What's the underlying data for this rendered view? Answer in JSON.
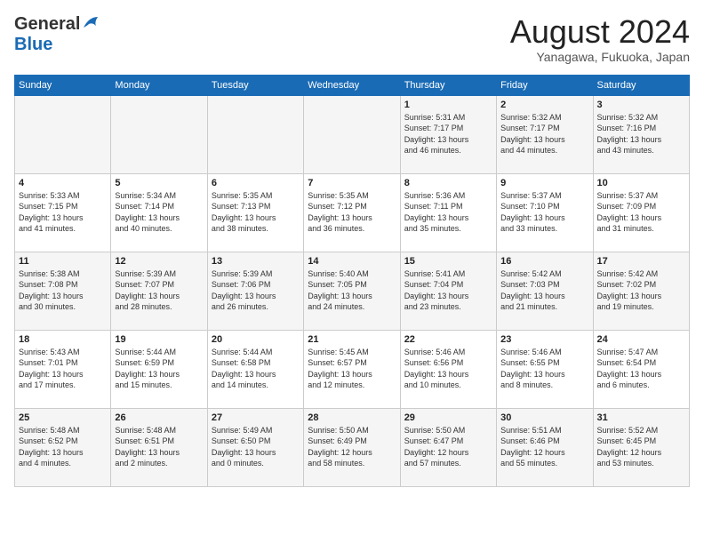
{
  "header": {
    "logo_general": "General",
    "logo_blue": "Blue",
    "month_title": "August 2024",
    "location": "Yanagawa, Fukuoka, Japan"
  },
  "calendar": {
    "days_of_week": [
      "Sunday",
      "Monday",
      "Tuesday",
      "Wednesday",
      "Thursday",
      "Friday",
      "Saturday"
    ],
    "weeks": [
      [
        {
          "day": "",
          "info": ""
        },
        {
          "day": "",
          "info": ""
        },
        {
          "day": "",
          "info": ""
        },
        {
          "day": "",
          "info": ""
        },
        {
          "day": "1",
          "info": "Sunrise: 5:31 AM\nSunset: 7:17 PM\nDaylight: 13 hours\nand 46 minutes."
        },
        {
          "day": "2",
          "info": "Sunrise: 5:32 AM\nSunset: 7:17 PM\nDaylight: 13 hours\nand 44 minutes."
        },
        {
          "day": "3",
          "info": "Sunrise: 5:32 AM\nSunset: 7:16 PM\nDaylight: 13 hours\nand 43 minutes."
        }
      ],
      [
        {
          "day": "4",
          "info": "Sunrise: 5:33 AM\nSunset: 7:15 PM\nDaylight: 13 hours\nand 41 minutes."
        },
        {
          "day": "5",
          "info": "Sunrise: 5:34 AM\nSunset: 7:14 PM\nDaylight: 13 hours\nand 40 minutes."
        },
        {
          "day": "6",
          "info": "Sunrise: 5:35 AM\nSunset: 7:13 PM\nDaylight: 13 hours\nand 38 minutes."
        },
        {
          "day": "7",
          "info": "Sunrise: 5:35 AM\nSunset: 7:12 PM\nDaylight: 13 hours\nand 36 minutes."
        },
        {
          "day": "8",
          "info": "Sunrise: 5:36 AM\nSunset: 7:11 PM\nDaylight: 13 hours\nand 35 minutes."
        },
        {
          "day": "9",
          "info": "Sunrise: 5:37 AM\nSunset: 7:10 PM\nDaylight: 13 hours\nand 33 minutes."
        },
        {
          "day": "10",
          "info": "Sunrise: 5:37 AM\nSunset: 7:09 PM\nDaylight: 13 hours\nand 31 minutes."
        }
      ],
      [
        {
          "day": "11",
          "info": "Sunrise: 5:38 AM\nSunset: 7:08 PM\nDaylight: 13 hours\nand 30 minutes."
        },
        {
          "day": "12",
          "info": "Sunrise: 5:39 AM\nSunset: 7:07 PM\nDaylight: 13 hours\nand 28 minutes."
        },
        {
          "day": "13",
          "info": "Sunrise: 5:39 AM\nSunset: 7:06 PM\nDaylight: 13 hours\nand 26 minutes."
        },
        {
          "day": "14",
          "info": "Sunrise: 5:40 AM\nSunset: 7:05 PM\nDaylight: 13 hours\nand 24 minutes."
        },
        {
          "day": "15",
          "info": "Sunrise: 5:41 AM\nSunset: 7:04 PM\nDaylight: 13 hours\nand 23 minutes."
        },
        {
          "day": "16",
          "info": "Sunrise: 5:42 AM\nSunset: 7:03 PM\nDaylight: 13 hours\nand 21 minutes."
        },
        {
          "day": "17",
          "info": "Sunrise: 5:42 AM\nSunset: 7:02 PM\nDaylight: 13 hours\nand 19 minutes."
        }
      ],
      [
        {
          "day": "18",
          "info": "Sunrise: 5:43 AM\nSunset: 7:01 PM\nDaylight: 13 hours\nand 17 minutes."
        },
        {
          "day": "19",
          "info": "Sunrise: 5:44 AM\nSunset: 6:59 PM\nDaylight: 13 hours\nand 15 minutes."
        },
        {
          "day": "20",
          "info": "Sunrise: 5:44 AM\nSunset: 6:58 PM\nDaylight: 13 hours\nand 14 minutes."
        },
        {
          "day": "21",
          "info": "Sunrise: 5:45 AM\nSunset: 6:57 PM\nDaylight: 13 hours\nand 12 minutes."
        },
        {
          "day": "22",
          "info": "Sunrise: 5:46 AM\nSunset: 6:56 PM\nDaylight: 13 hours\nand 10 minutes."
        },
        {
          "day": "23",
          "info": "Sunrise: 5:46 AM\nSunset: 6:55 PM\nDaylight: 13 hours\nand 8 minutes."
        },
        {
          "day": "24",
          "info": "Sunrise: 5:47 AM\nSunset: 6:54 PM\nDaylight: 13 hours\nand 6 minutes."
        }
      ],
      [
        {
          "day": "25",
          "info": "Sunrise: 5:48 AM\nSunset: 6:52 PM\nDaylight: 13 hours\nand 4 minutes."
        },
        {
          "day": "26",
          "info": "Sunrise: 5:48 AM\nSunset: 6:51 PM\nDaylight: 13 hours\nand 2 minutes."
        },
        {
          "day": "27",
          "info": "Sunrise: 5:49 AM\nSunset: 6:50 PM\nDaylight: 13 hours\nand 0 minutes."
        },
        {
          "day": "28",
          "info": "Sunrise: 5:50 AM\nSunset: 6:49 PM\nDaylight: 12 hours\nand 58 minutes."
        },
        {
          "day": "29",
          "info": "Sunrise: 5:50 AM\nSunset: 6:47 PM\nDaylight: 12 hours\nand 57 minutes."
        },
        {
          "day": "30",
          "info": "Sunrise: 5:51 AM\nSunset: 6:46 PM\nDaylight: 12 hours\nand 55 minutes."
        },
        {
          "day": "31",
          "info": "Sunrise: 5:52 AM\nSunset: 6:45 PM\nDaylight: 12 hours\nand 53 minutes."
        }
      ]
    ]
  }
}
